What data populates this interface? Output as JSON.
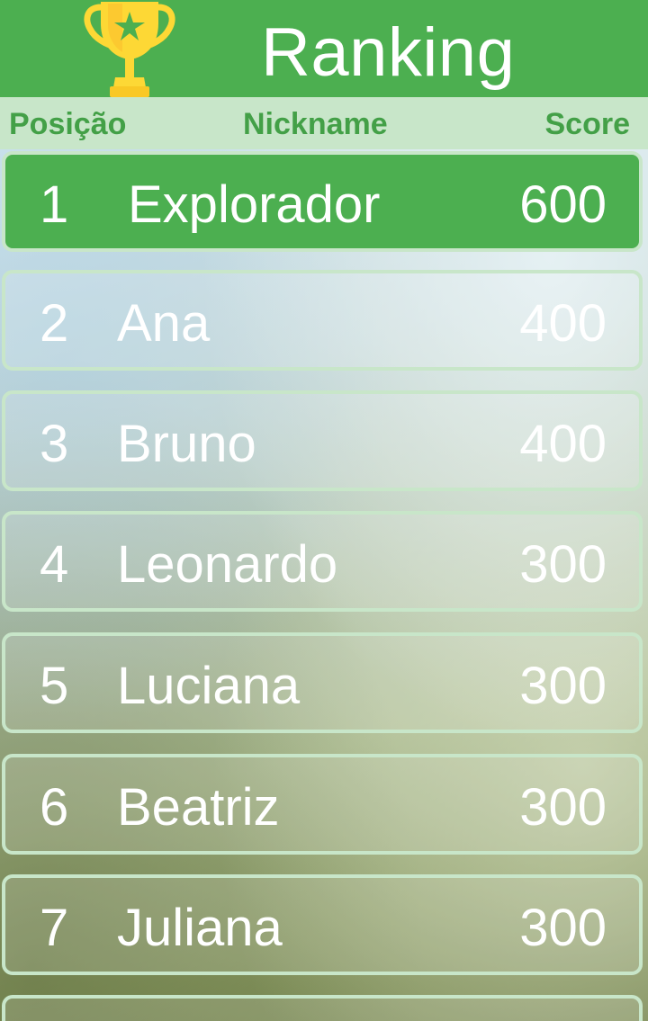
{
  "header": {
    "title": "Ranking"
  },
  "columns": {
    "position": "Posição",
    "nickname": "Nickname",
    "score": "Score"
  },
  "rows": [
    {
      "position": "1",
      "nickname": "Explorador",
      "score": "600"
    },
    {
      "position": "2",
      "nickname": "Ana",
      "score": "400"
    },
    {
      "position": "3",
      "nickname": "Bruno",
      "score": "400"
    },
    {
      "position": "4",
      "nickname": "Leonardo",
      "score": "300"
    },
    {
      "position": "5",
      "nickname": "Luciana",
      "score": "300"
    },
    {
      "position": "6",
      "nickname": "Beatriz",
      "score": "300"
    },
    {
      "position": "7",
      "nickname": "Juliana",
      "score": "300"
    },
    {
      "position": "",
      "nickname": "",
      "score": ""
    }
  ],
  "colors": {
    "primary": "#4caf50",
    "light": "#c8e6c9",
    "trophy": "#fdd835"
  },
  "icons": {
    "header": "trophy-icon"
  }
}
